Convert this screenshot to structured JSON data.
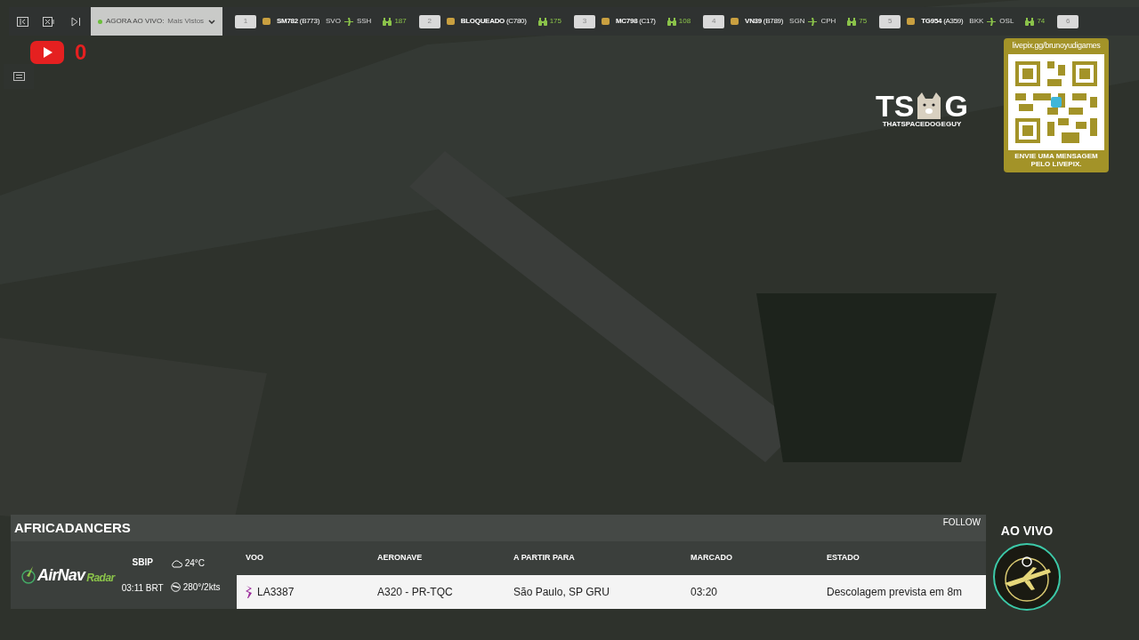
{
  "toolbar": {
    "live_dropdown": {
      "label": "AGORA AO VIVO:",
      "value": "Mais Vistos"
    }
  },
  "flights": [
    {
      "rank": "1",
      "callsign": "SM782",
      "aircraft": "(B773)",
      "from": "SVO",
      "to": "SSH",
      "viewers": "187"
    },
    {
      "rank": "2",
      "callsign": "BLOQUEADO",
      "aircraft": "(C780)",
      "viewers": "175"
    },
    {
      "rank": "3",
      "callsign": "MC798",
      "aircraft": "(C17)",
      "viewers": "108"
    },
    {
      "rank": "4",
      "callsign": "VN39",
      "aircraft": "(B789)",
      "from": "SGN",
      "to": "CPH",
      "viewers": "75"
    },
    {
      "rank": "5",
      "callsign": "TG954",
      "aircraft": "(A359)",
      "from": "BKK",
      "to": "OSL",
      "viewers": "74"
    },
    {
      "rank": "6"
    }
  ],
  "youtube": {
    "count": "0"
  },
  "streamer_logo": {
    "letters_left": "TS",
    "letters_right": "G",
    "name": "THATSPACEDOGEGUY"
  },
  "qr_card": {
    "url": "livepix.gg/brunoyudigames",
    "caption": "ENVIE UMA MENSAGEM PELO LIVEPIX."
  },
  "flight_panel": {
    "title": "AFRICADANCERS",
    "follow": "FOLLOW",
    "brand": "AirNav",
    "brand_sub": "Radar",
    "airport": "SBIP",
    "local_time": "03:11 BRT",
    "temperature": "24°C",
    "wind": "280°/2kts",
    "columns": [
      "VOO",
      "AERONAVE",
      "A PARTIR PARA",
      "MARCADO",
      "ESTADO"
    ],
    "row": [
      "LA3387",
      "A320 - PR-TQC",
      "São Paulo, SP GRU",
      "03:20",
      "Descolagem prevista em 8m"
    ]
  },
  "live_badge": {
    "label": "AO VIVO"
  }
}
